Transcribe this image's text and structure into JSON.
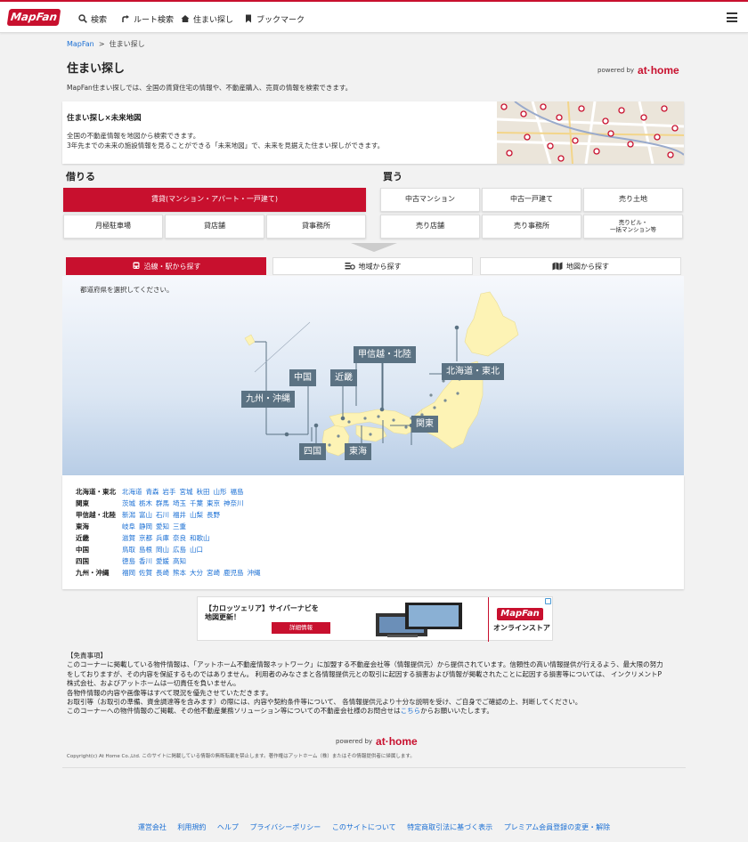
{
  "header": {
    "logo": "MapFan",
    "nav": [
      {
        "label": "検索",
        "icon": "search-icon"
      },
      {
        "label": "ルート検索",
        "icon": "route-icon"
      },
      {
        "label": "住まい探し",
        "icon": "house-icon"
      },
      {
        "label": "ブックマーク",
        "icon": "bookmark-icon"
      }
    ],
    "menu_icon": "hamburger-icon"
  },
  "breadcrumb": {
    "home": "MapFan",
    "separator": ">",
    "current": "住まい探し"
  },
  "page": {
    "title": "住まい探し",
    "powered_by": "powered by",
    "brand": "at·home",
    "intro": "MapFan住まい探しでは、全国の賃貸住宅の情報や、不動産購入、売買の情報を検索できます。"
  },
  "promo": {
    "title": "住まい探し×未来地図",
    "line1": "全国の不動産情報を地図から検索できます。",
    "line2": "3年先までの未来の施設情報を見ることができる「未来地図」で、未来を見据えた住まい探しができます。"
  },
  "rent": {
    "heading": "借りる",
    "main": "賃貸(マンション・アパート・一戸建て)",
    "items": [
      "月極駐車場",
      "貸店舗",
      "貸事務所"
    ]
  },
  "buy": {
    "heading": "買う",
    "row1": [
      "中古マンション",
      "中古一戸建て",
      "売り土地"
    ],
    "row2": [
      "売り店舗",
      "売り事務所"
    ],
    "last_line1": "売りビル・",
    "last_line2": "一括マンション等"
  },
  "search_tabs": [
    {
      "label": "沿線・駅から探す",
      "icon": "train-icon",
      "active": true
    },
    {
      "label": "地域から探す",
      "icon": "area-icon",
      "active": false
    },
    {
      "label": "地図から探す",
      "icon": "map-icon",
      "active": false
    }
  ],
  "map": {
    "hint": "都道府県を選択してください。",
    "regions": [
      "甲信越・北陸",
      "中国",
      "近畿",
      "北海道・東北",
      "九州・沖縄",
      "関東",
      "四国",
      "東海"
    ]
  },
  "prefectures": [
    {
      "region": "北海道・東北",
      "prefs": [
        "北海道",
        "青森",
        "岩手",
        "宮城",
        "秋田",
        "山形",
        "福島"
      ]
    },
    {
      "region": "関東",
      "prefs": [
        "茨城",
        "栃木",
        "群馬",
        "埼玉",
        "千葉",
        "東京",
        "神奈川"
      ]
    },
    {
      "region": "甲信越・北陸",
      "prefs": [
        "新潟",
        "富山",
        "石川",
        "福井",
        "山梨",
        "長野"
      ]
    },
    {
      "region": "東海",
      "prefs": [
        "岐阜",
        "静岡",
        "愛知",
        "三重"
      ]
    },
    {
      "region": "近畿",
      "prefs": [
        "滋賀",
        "京都",
        "兵庫",
        "奈良",
        "和歌山"
      ]
    },
    {
      "region": "中国",
      "prefs": [
        "鳥取",
        "島根",
        "岡山",
        "広島",
        "山口"
      ]
    },
    {
      "region": "四国",
      "prefs": [
        "徳島",
        "香川",
        "愛媛",
        "高知"
      ]
    },
    {
      "region": "九州・沖縄",
      "prefs": [
        "福岡",
        "佐賀",
        "長崎",
        "熊本",
        "大分",
        "宮崎",
        "鹿児島",
        "沖縄"
      ]
    }
  ],
  "ad": {
    "line1": "【カロッツェリア】サイバーナビを",
    "line2": "地図更新！",
    "button": "詳細情報",
    "brand": "MapFan",
    "store": "オンラインストア"
  },
  "disclaimer": {
    "title": "【免責事項】",
    "l1": "このコーナーに掲載している物件情報は、「アットホーム不動産情報ネットワーク」に加盟する不動産会社等（情報提供元）から提供されています。信頼性の高い情報提供が行えるよう、最大限の努力",
    "l2": "をしておりますが、その内容を保証するものではありません。 利用者のみなさまと各情報提供元との取引に起因する損害および情報が掲載されたことに起因する損害等については、 インクリメントP",
    "l3": "株式会社、およびアットホームは一切責任を負いません。",
    "l4": "各物件情報の内容や画像等はすべて現況を優先させていただきます。",
    "l5": "お取引等（お取引の準備、資金調達等を含みます）の際には、内容や契約条件等について、 各情報提供元より十分な説明を受け、ご自身でご確認の上、判断してください。",
    "l6a": "このコーナーへの物件情報のご掲載、その他不動産業務ソリューション等についての不動産会社様のお問合せは",
    "link": "こちら",
    "l6b": "からお願いいたします。"
  },
  "copyright": "Copyright(c) At Home Co.,Ltd. このサイトに掲載している情報の無断転載を禁止します。著作権はアットホーム（株）またはその情報提供者に帰属します。",
  "footer": [
    "運営会社",
    "利用規約",
    "ヘルプ",
    "プライバシーポリシー",
    "このサイトについて",
    "特定商取引法に基づく表示",
    "プレミアム会員登録の変更・解除"
  ],
  "colors": {
    "brand_red": "#c8102e",
    "link_blue": "#1a6fd4",
    "region_label": "#5b7283",
    "land": "#fdf3b5"
  }
}
